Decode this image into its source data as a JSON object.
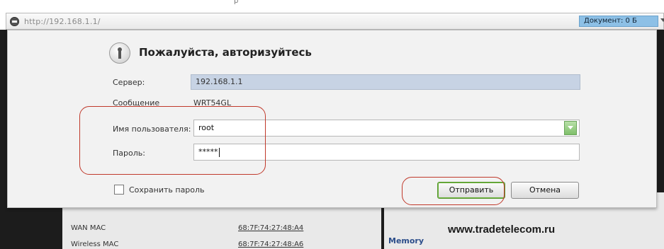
{
  "top_marker": "р",
  "address_bar": {
    "url": "http://192.168.1.1/",
    "document_status": "Документ: 0 Б"
  },
  "dialog": {
    "title": "Пожалуйста, авторизуйтесь",
    "server_label": "Сервер:",
    "server_value": "192.168.1.1",
    "message_label": "Сообщение",
    "message_value": "WRT54GL",
    "username_label": "Имя пользователя:",
    "username_value": "root",
    "password_label": "Пароль:",
    "password_value": "*****",
    "remember_label": "Сохранить пароль",
    "submit_label": "Отправить",
    "cancel_label": "Отмена"
  },
  "background_page": {
    "wan_mac_label": "WAN MAC",
    "wan_mac_value": "68:7F:74:27:48:A4",
    "wireless_mac_label": "Wireless MAC",
    "wireless_mac_value": "68:7F:74:27:48:A6",
    "memory_label": "Memory"
  },
  "watermark": "www.tradetelecom.ru",
  "colors": {
    "highlight": "#c0392b",
    "doc_badge": "#8dc0e6",
    "server_field": "#c7d3e4"
  },
  "icons": [
    "stop-icon",
    "lock-icon",
    "dropdown-arrow-icon"
  ]
}
